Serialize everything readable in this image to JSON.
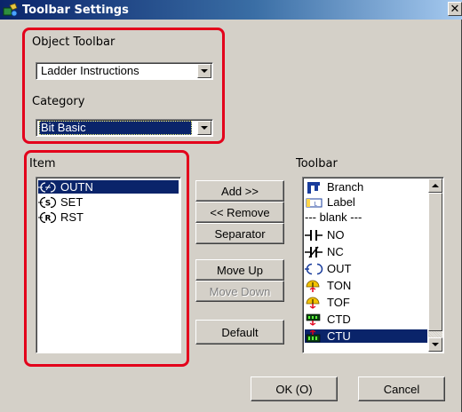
{
  "window": {
    "title": "Toolbar Settings",
    "close_glyph": "✕"
  },
  "object_toolbar": {
    "label": "Object Toolbar",
    "selected": "Ladder Instructions"
  },
  "category": {
    "label": "Category",
    "selected": "Bit Basic"
  },
  "item": {
    "label": "Item",
    "items": [
      {
        "label": "OUTN",
        "icon": "outn-coil-icon",
        "selected": true
      },
      {
        "label": "SET",
        "icon": "set-coil-icon",
        "selected": false
      },
      {
        "label": "RST",
        "icon": "rst-coil-icon",
        "selected": false
      }
    ]
  },
  "buttons": {
    "add": "Add >>",
    "remove": "<< Remove",
    "separator": "Separator",
    "move_up": "Move Up",
    "move_down": "Move Down",
    "default": "Default",
    "ok": "OK (O)",
    "cancel": "Cancel"
  },
  "toolbar": {
    "label": "Toolbar",
    "items": [
      {
        "label": "Branch",
        "icon": "branch-icon",
        "selected": false
      },
      {
        "label": "Label",
        "icon": "label-icon",
        "selected": false
      },
      {
        "label": "--- blank ---",
        "icon": "none",
        "selected": false
      },
      {
        "label": "NO",
        "icon": "no-contact-icon",
        "selected": false
      },
      {
        "label": "NC",
        "icon": "nc-contact-icon",
        "selected": false
      },
      {
        "label": "OUT",
        "icon": "out-coil-icon",
        "selected": false
      },
      {
        "label": "TON",
        "icon": "ton-timer-icon",
        "selected": false
      },
      {
        "label": "TOF",
        "icon": "tof-timer-icon",
        "selected": false
      },
      {
        "label": "CTD",
        "icon": "ctd-counter-icon",
        "selected": false
      },
      {
        "label": "CTU",
        "icon": "ctu-counter-icon",
        "selected": true
      }
    ]
  },
  "colors": {
    "highlight": "#0a246a",
    "annotation": "#e3001b",
    "dialog_bg": "#d4d0c8"
  }
}
